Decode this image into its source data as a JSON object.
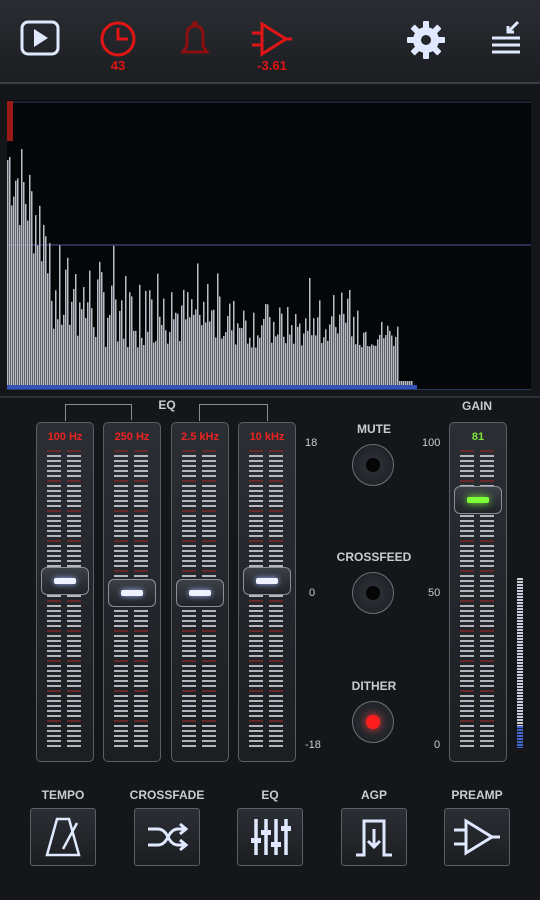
{
  "toolbar": {
    "timer_value": "43",
    "delay_value": "-3.61"
  },
  "eq_section": {
    "label": "EQ",
    "scale_top": "18",
    "scale_mid": "0",
    "scale_bottom": "-18",
    "bands": [
      {
        "label": "100 Hz",
        "level": 0.0
      },
      {
        "label": "250 Hz",
        "level": 0.0
      },
      {
        "label": "2.5 kHz",
        "level": 0.0
      },
      {
        "label": "10 kHz",
        "level": 0.0
      }
    ]
  },
  "toggles": {
    "mute_label": "MUTE",
    "crossfeed_label": "CROSSFEED",
    "dither_label": "DITHER"
  },
  "gain": {
    "label": "GAIN",
    "value": "81",
    "scale_top": "100",
    "scale_mid": "50",
    "scale_bottom": "0"
  },
  "bottom_buttons": {
    "tempo": "TEMPO",
    "crossfade": "CROSSFADE",
    "eq": "EQ",
    "agp": "AGP",
    "preamp": "PREAMP"
  },
  "colors": {
    "accent_red": "#e01515",
    "gain_green": "#7dff3a",
    "knob_light": "#eef2ff"
  },
  "icons": [
    "play-icon",
    "timer-icon",
    "alarm-bell-icon",
    "delay-icon",
    "settings-gear-icon",
    "menu-collapse-icon",
    "metronome-icon",
    "shuffle-icon",
    "equalizer-icon",
    "agp-icon",
    "preamp-icon"
  ]
}
